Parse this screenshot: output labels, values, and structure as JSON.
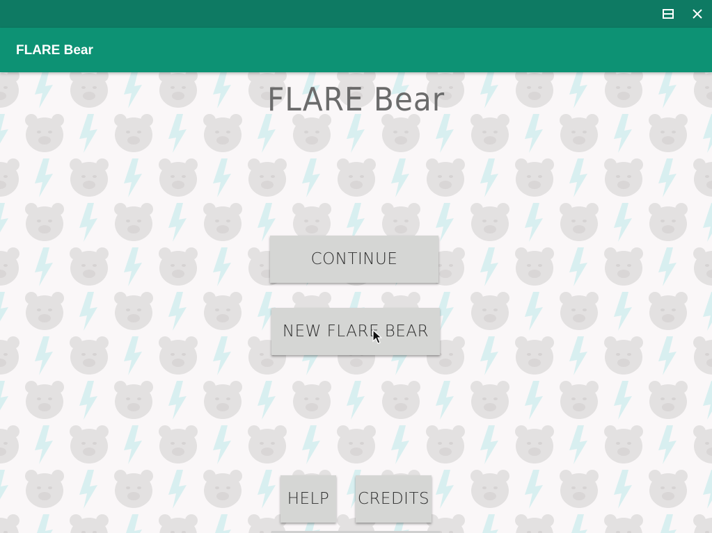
{
  "window": {
    "maximize_icon": "window-maximize-icon",
    "close_icon": "close-icon"
  },
  "appbar": {
    "title": "FLARE Bear"
  },
  "main": {
    "heading": "FLARE Bear",
    "buttons": {
      "continue": "CONTINUE",
      "new_bear": "NEW FLARE BEAR",
      "help": "HELP",
      "credits": "CREDITS"
    }
  },
  "colors": {
    "titlebar": "#0e7a63",
    "appbar": "#0d9274",
    "background": "#faf7f8",
    "button": "#d5d6d4",
    "pattern_bear": "#e3e1e1",
    "pattern_bolt": "#d8eff0"
  }
}
